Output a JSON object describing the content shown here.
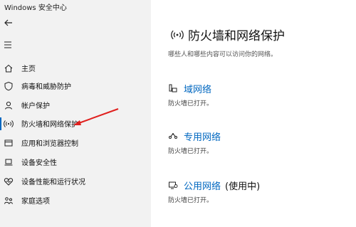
{
  "window": {
    "title": "Windows 安全中心"
  },
  "sidebar": {
    "items": [
      {
        "label": "主页",
        "icon": "home-icon"
      },
      {
        "label": "病毒和威胁防护",
        "icon": "shield-icon"
      },
      {
        "label": "帐户保护",
        "icon": "person-icon"
      },
      {
        "label": "防火墙和网络保护",
        "icon": "wifi-signal-icon",
        "selected": true
      },
      {
        "label": "应用和浏览器控制",
        "icon": "app-window-icon"
      },
      {
        "label": "设备安全性",
        "icon": "laptop-icon"
      },
      {
        "label": "设备性能和运行状况",
        "icon": "heart-icon"
      },
      {
        "label": "家庭选项",
        "icon": "family-icon"
      }
    ]
  },
  "main": {
    "title": "防火墙和网络保护",
    "subtitle": "哪些人和哪些内容可以访问你的网络。",
    "networks": [
      {
        "link": "域网络",
        "suffix": "",
        "status": "防火墙已打开。",
        "icon": "domain-network-icon"
      },
      {
        "link": "专用网络",
        "suffix": "",
        "status": "防火墙已打开。",
        "icon": "private-network-icon"
      },
      {
        "link": "公用网络",
        "suffix": "(使用中)",
        "status": "防火墙已打开。",
        "icon": "public-network-icon"
      }
    ]
  },
  "colors": {
    "accent": "#0067c0",
    "annotation": "#e0201e",
    "sidebar_bg": "#f2f2f2"
  }
}
